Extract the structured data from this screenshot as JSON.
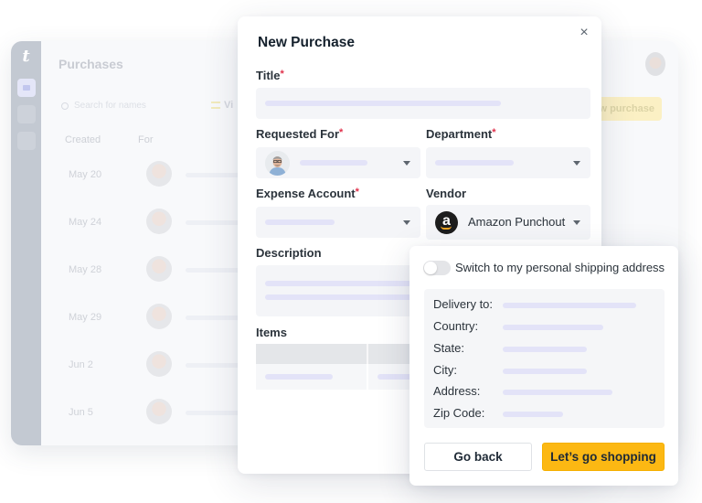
{
  "background_app": {
    "logo": "t",
    "page_title": "Purchases",
    "search_placeholder": "Search for names",
    "view_label": "Vi",
    "new_purchase_label": "w purchase",
    "columns": [
      "Created",
      "For"
    ],
    "rows": [
      {
        "created": "May 20",
        "avatar": "person-avatar"
      },
      {
        "created": "May 24",
        "avatar": "person-avatar"
      },
      {
        "created": "May 28",
        "avatar": "person-avatar"
      },
      {
        "created": "May 29",
        "avatar": "person-avatar"
      },
      {
        "created": "Jun 2",
        "avatar": "person-avatar"
      },
      {
        "created": "Jun 5",
        "avatar": "person-avatar"
      }
    ]
  },
  "modal": {
    "title": "New Purchase",
    "close_icon": "×",
    "required_mark": "*",
    "fields": {
      "title": {
        "label": "Title",
        "required": true
      },
      "requested_for": {
        "label": "Requested For",
        "required": true
      },
      "department": {
        "label": "Department",
        "required": true
      },
      "expense_account": {
        "label": "Expense Account",
        "required": true
      },
      "vendor": {
        "label": "Vendor",
        "required": false,
        "value": "Amazon Punchout",
        "logo_letter": "a"
      },
      "description": {
        "label": "Description"
      },
      "items": {
        "label": "Items"
      }
    }
  },
  "shipping_popover": {
    "toggle_label": "Switch to my personal shipping address",
    "toggle_on": false,
    "address_fields": [
      {
        "label": "Delivery to:"
      },
      {
        "label": "Country:"
      },
      {
        "label": "State:"
      },
      {
        "label": "City:"
      },
      {
        "label": "Address:"
      },
      {
        "label": "Zip Code:"
      }
    ],
    "buttons": {
      "back": "Go back",
      "shop": "Let’s go shopping"
    }
  },
  "colors": {
    "accent": "#fcb813",
    "required": "#e0314b",
    "placeholder_bar": "#e3e3f8",
    "sidebar": "#c3c9d2"
  }
}
